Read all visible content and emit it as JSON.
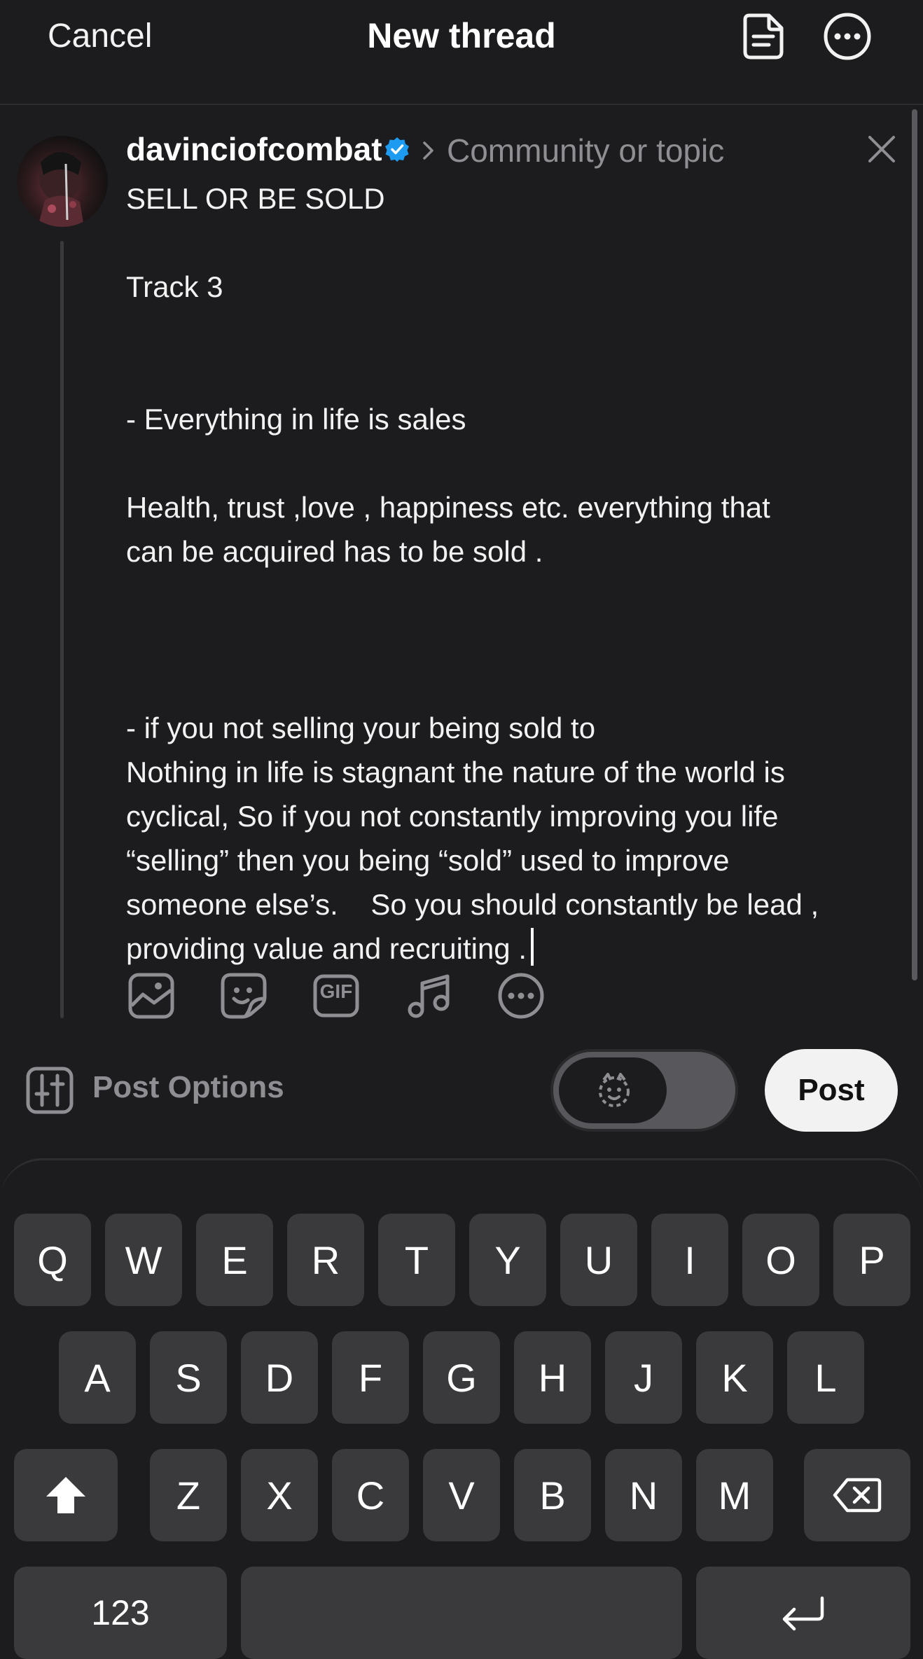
{
  "header": {
    "cancel_label": "Cancel",
    "title": "New thread",
    "drafts_icon": "drafts-icon",
    "more_icon": "more-icon"
  },
  "post": {
    "username": "davinciofcombat",
    "verified": true,
    "community_placeholder": "Community or topic",
    "lines": [
      "SELL OR BE SOLD",
      "",
      "Track 3",
      "",
      "",
      "- Everything in life is sales",
      "",
      "Health, trust ,love , happiness etc. everything that",
      "can be acquired has to be sold .",
      "",
      "",
      "",
      "- if you not selling your being sold to",
      "Nothing in life is stagnant the nature of the world is",
      "cyclical, So if you not constantly improving you life",
      "“selling” then you being “sold” used to improve",
      "someone else’s.    So you should constantly be lead ,",
      "providing value and recruiting ."
    ],
    "attachments": [
      "image-icon",
      "sticker-icon",
      "gif-icon",
      "music-icon",
      "more-icon"
    ],
    "gif_label": "GIF"
  },
  "options": {
    "label": "Post Options",
    "post_label": "Post"
  },
  "keyboard": {
    "row1": [
      "Q",
      "W",
      "E",
      "R",
      "T",
      "Y",
      "U",
      "I",
      "O",
      "P"
    ],
    "row2": [
      "A",
      "S",
      "D",
      "F",
      "G",
      "H",
      "J",
      "K",
      "L"
    ],
    "row3": [
      "Z",
      "X",
      "C",
      "V",
      "B",
      "N",
      "M"
    ],
    "numbers_label": "123"
  },
  "colors": {
    "background": "#1c1c1e",
    "key": "#3a3a3c",
    "verified": "#1d9bf0",
    "muted": "#8e8e93"
  }
}
